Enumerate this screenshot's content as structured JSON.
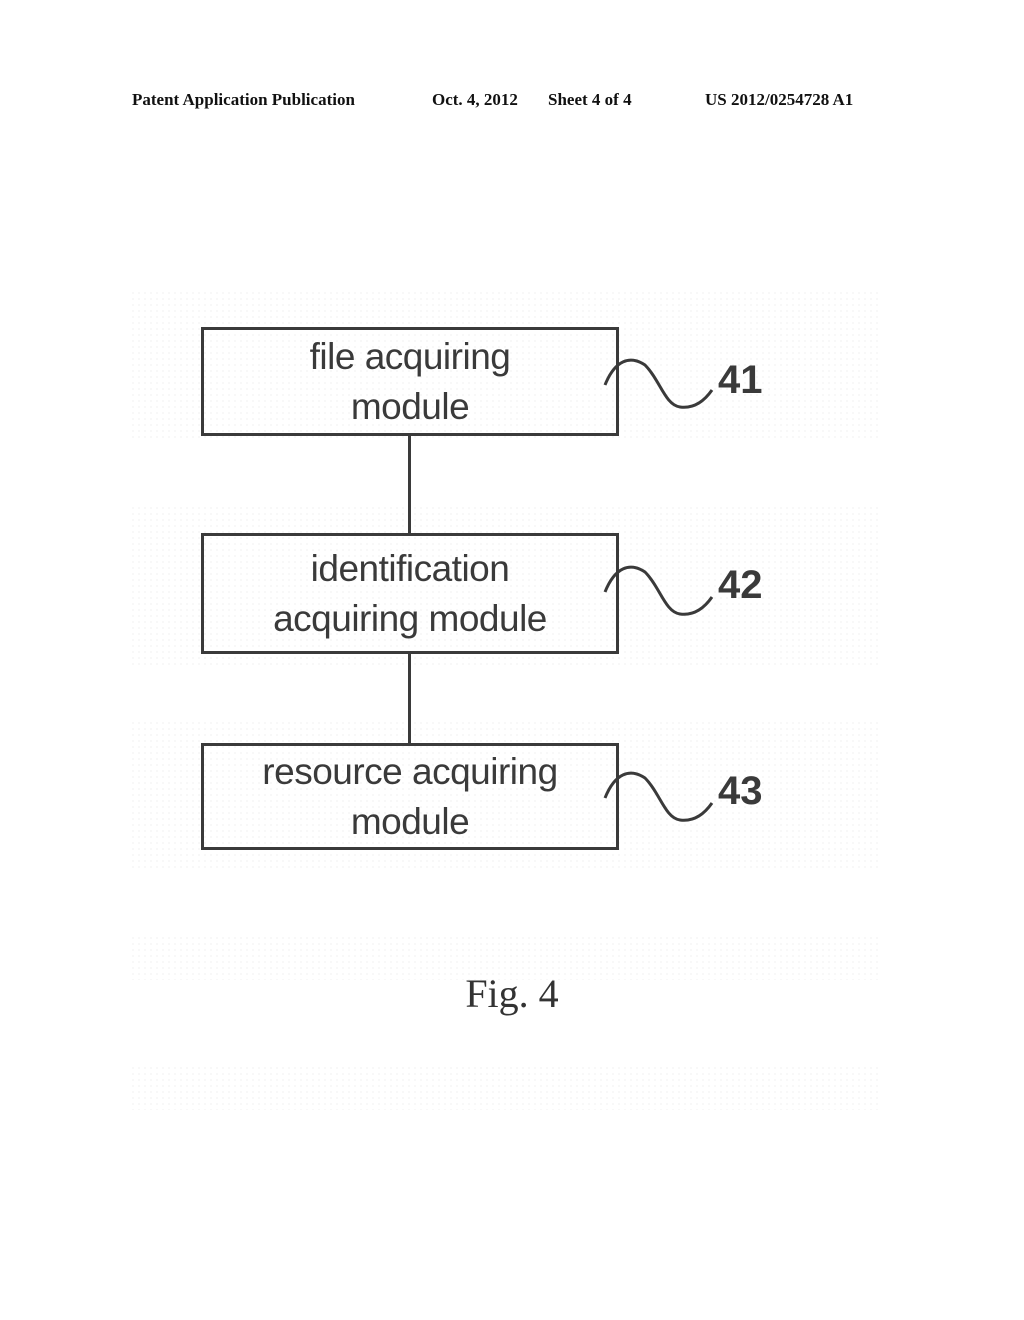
{
  "header": {
    "publication": "Patent Application Publication",
    "date": "Oct. 4, 2012",
    "sheet": "Sheet 4 of 4",
    "number": "US 2012/0254728 A1"
  },
  "diagram": {
    "modules": [
      {
        "lines": [
          "file acquiring",
          "module"
        ],
        "ref": "41"
      },
      {
        "lines": [
          "identification",
          "acquiring module"
        ],
        "ref": "42"
      },
      {
        "lines": [
          "resource acquiring",
          "module"
        ],
        "ref": "43"
      }
    ],
    "connections": [
      [
        "41",
        "42"
      ],
      [
        "42",
        "43"
      ]
    ]
  },
  "figure_label": "Fig. 4"
}
